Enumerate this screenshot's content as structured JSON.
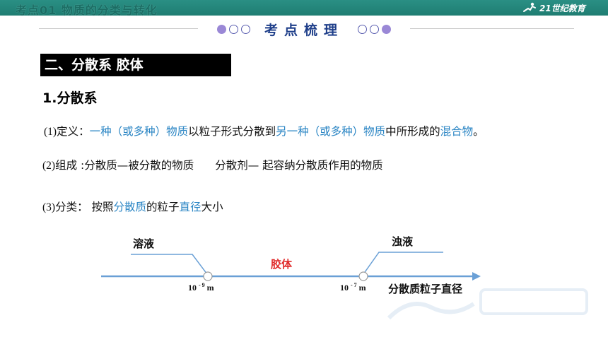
{
  "topbar": {
    "title": "考点01  物质的分类与转化",
    "logo_text": "21世纪教育"
  },
  "section": {
    "title": "考点梳理"
  },
  "bar": {
    "label": "二、分散系  胶体"
  },
  "heading": "1.分散系",
  "definition": {
    "prefix": "(1)",
    "p1": "定义：",
    "h1": "一种（或多种）物质",
    "p2": "以粒子形式分散到",
    "h2": "另一种（或多种）物质",
    "p3": "中所形成的",
    "h3": "混合物",
    "p4": "。"
  },
  "composition": {
    "prefix": "(2)",
    "text1": "组成 :分散质—被分散的物质",
    "text2": "分散剂— 起容纳分散质作用的物质"
  },
  "classification": {
    "prefix": "(3)",
    "p1": "分类：  按照",
    "h1": "分散质",
    "p2": "的粒子",
    "h2": "直径",
    "p3": "大小"
  },
  "diagram": {
    "left_label": "溶液",
    "middle_label": "胶体",
    "right_label": "浊液",
    "tick1_base": "10",
    "tick1_exp": "- 9",
    "tick1_unit": "m",
    "tick2_base": "10",
    "tick2_exp": "- 7",
    "tick2_unit": "m",
    "axis_label": "分散质粒子直径"
  },
  "colors": {
    "accent_blue": "#2a85c4",
    "colloid_red": "#e02b2b",
    "axis_blue": "#6aa0d6",
    "topbar": "#2a8f84"
  }
}
